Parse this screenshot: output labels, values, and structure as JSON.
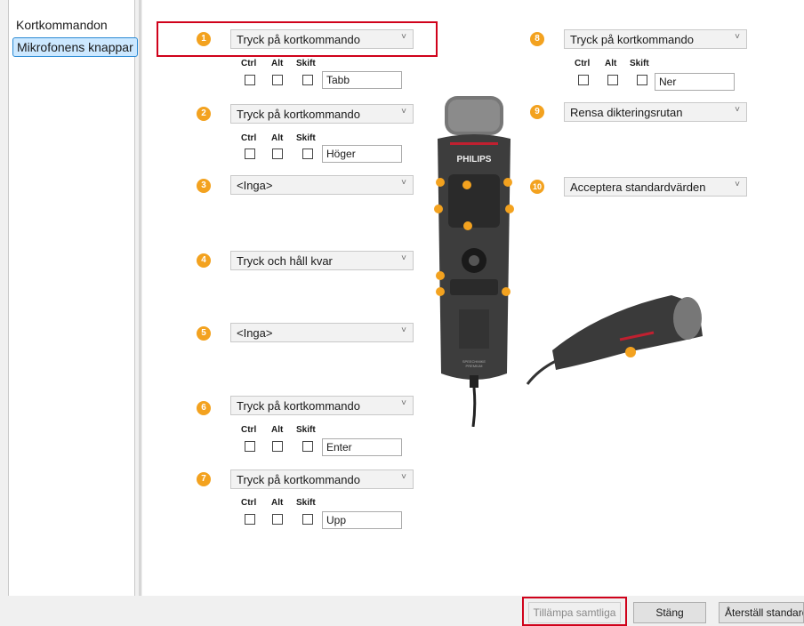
{
  "sidebar": {
    "items": [
      {
        "label": "Kortkommandon",
        "selected": false
      },
      {
        "label": "Mikrofonens knappar",
        "selected": true
      }
    ]
  },
  "modifiers": {
    "ctrl": "Ctrl",
    "alt": "Alt",
    "shift": "Skift"
  },
  "buttons": [
    {
      "number": "1",
      "action": "Tryck på kortkommando",
      "key": "Tabb",
      "highlighted": true
    },
    {
      "number": "2",
      "action": "Tryck på kortkommando",
      "key": "Höger"
    },
    {
      "number": "3",
      "action": "<Inga>"
    },
    {
      "number": "4",
      "action": "Tryck och håll kvar"
    },
    {
      "number": "5",
      "action": "<Inga>"
    },
    {
      "number": "6",
      "action": "Tryck på kortkommando",
      "key": "Enter"
    },
    {
      "number": "7",
      "action": "Tryck på kortkommando",
      "key": "Upp"
    },
    {
      "number": "8",
      "action": "Tryck på kortkommando",
      "key": "Ner"
    },
    {
      "number": "9",
      "action": "Rensa dikteringsrutan"
    },
    {
      "number": "10",
      "action": "Acceptera standardvärden"
    }
  ],
  "device": {
    "brand": "PHILIPS",
    "model_line1": "SPEECHMIKE",
    "model_line2": "PREMIUM"
  },
  "footer": {
    "apply_all": "Tillämpa samtliga",
    "close": "Stäng",
    "reset_defaults": "Återställ standard"
  },
  "colors": {
    "badge": "#f3a21f",
    "highlight": "#d0021b",
    "selection": "#cce8ff"
  }
}
